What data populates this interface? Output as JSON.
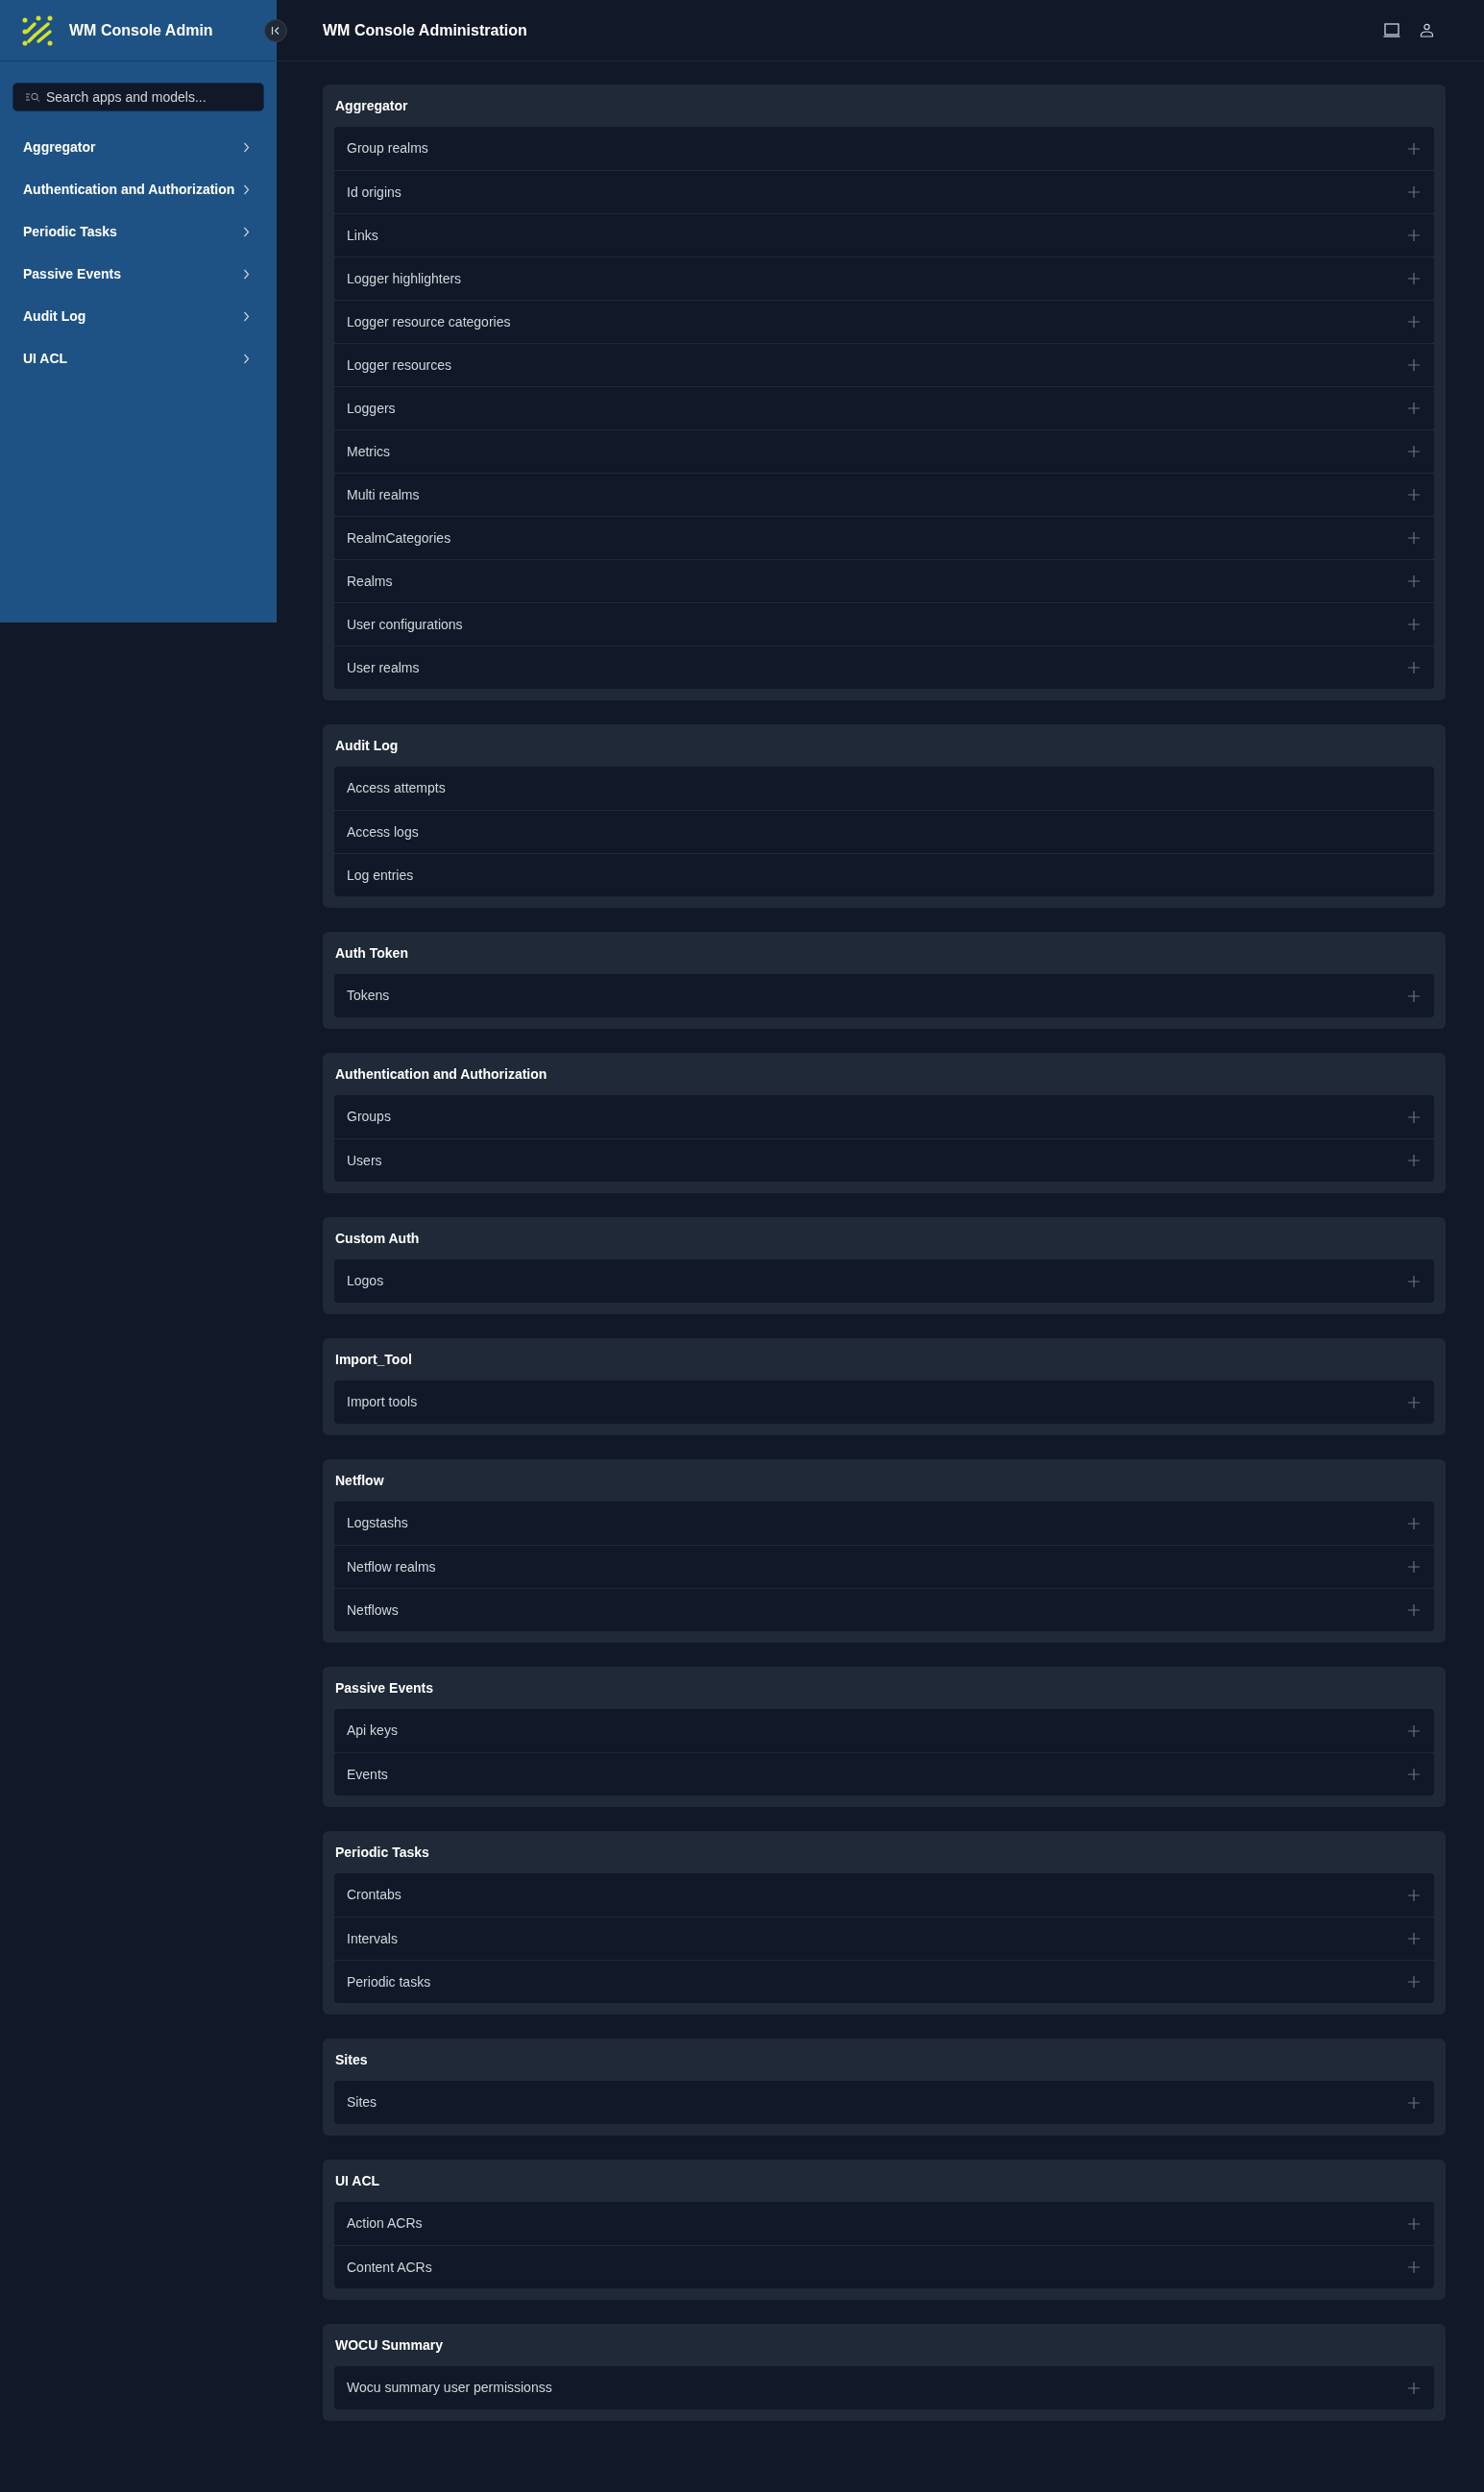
{
  "sidebar": {
    "title": "WM Console Admin",
    "search": {
      "placeholder": "Search apps and models..."
    },
    "items": [
      {
        "label": "Aggregator"
      },
      {
        "label": "Authentication and Authorization"
      },
      {
        "label": "Periodic Tasks"
      },
      {
        "label": "Passive Events"
      },
      {
        "label": "Audit Log"
      },
      {
        "label": "UI ACL"
      }
    ]
  },
  "header": {
    "title": "WM Console Administration"
  },
  "apps": [
    {
      "name": "Aggregator",
      "models": [
        {
          "label": "Group realms",
          "add": true
        },
        {
          "label": "Id origins",
          "add": true
        },
        {
          "label": "Links",
          "add": true
        },
        {
          "label": "Logger highlighters",
          "add": true
        },
        {
          "label": "Logger resource categories",
          "add": true
        },
        {
          "label": "Logger resources",
          "add": true
        },
        {
          "label": "Loggers",
          "add": true
        },
        {
          "label": "Metrics",
          "add": true
        },
        {
          "label": "Multi realms",
          "add": true
        },
        {
          "label": "RealmCategories",
          "add": true
        },
        {
          "label": "Realms",
          "add": true
        },
        {
          "label": "User configurations",
          "add": true
        },
        {
          "label": "User realms",
          "add": true
        }
      ]
    },
    {
      "name": "Audit Log",
      "models": [
        {
          "label": "Access attempts",
          "add": false
        },
        {
          "label": "Access logs",
          "add": false
        },
        {
          "label": "Log entries",
          "add": false
        }
      ]
    },
    {
      "name": "Auth Token",
      "models": [
        {
          "label": "Tokens",
          "add": true
        }
      ]
    },
    {
      "name": "Authentication and Authorization",
      "models": [
        {
          "label": "Groups",
          "add": true
        },
        {
          "label": "Users",
          "add": true
        }
      ]
    },
    {
      "name": "Custom Auth",
      "models": [
        {
          "label": "Logos",
          "add": true
        }
      ]
    },
    {
      "name": "Import_Tool",
      "models": [
        {
          "label": "Import tools",
          "add": true
        }
      ]
    },
    {
      "name": "Netflow",
      "models": [
        {
          "label": "Logstashs",
          "add": true
        },
        {
          "label": "Netflow realms",
          "add": true
        },
        {
          "label": "Netflows",
          "add": true
        }
      ]
    },
    {
      "name": "Passive Events",
      "models": [
        {
          "label": "Api keys",
          "add": true
        },
        {
          "label": "Events",
          "add": true
        }
      ]
    },
    {
      "name": "Periodic Tasks",
      "models": [
        {
          "label": "Crontabs",
          "add": true
        },
        {
          "label": "Intervals",
          "add": true
        },
        {
          "label": "Periodic tasks",
          "add": true
        }
      ]
    },
    {
      "name": "Sites",
      "models": [
        {
          "label": "Sites",
          "add": true
        }
      ]
    },
    {
      "name": "UI ACL",
      "models": [
        {
          "label": "Action ACRs",
          "add": true
        },
        {
          "label": "Content ACRs",
          "add": true
        }
      ]
    },
    {
      "name": "WOCU Summary",
      "models": [
        {
          "label": "Wocu summary user permissionss",
          "add": true
        }
      ]
    }
  ]
}
